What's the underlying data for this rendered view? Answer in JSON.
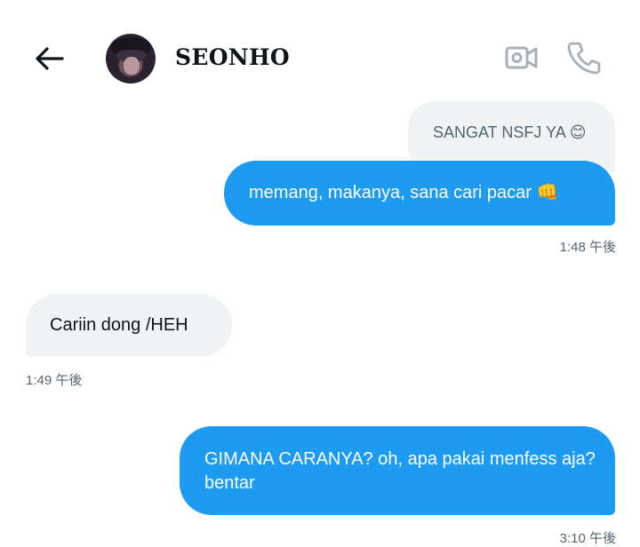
{
  "header": {
    "contact_name": "SEONHO",
    "back_icon": "arrow-left-icon",
    "video_icon": "video-camera-icon",
    "call_icon": "phone-icon",
    "icon_color": "#a7b0b8"
  },
  "messages": [
    {
      "side": "received",
      "text": "SANGAT NSFJ YA 😊"
    },
    {
      "side": "sent",
      "text": "memang, makanya, sana cari pacar 👊"
    },
    {
      "side": "sent",
      "timestamp": "1:48 午後"
    },
    {
      "side": "received",
      "text": "Cariin dong /HEH"
    },
    {
      "side": "received",
      "timestamp": "1:49 午後"
    },
    {
      "side": "sent",
      "text": "GIMANA CARANYA? oh, apa pakai menfess aja? bentar"
    },
    {
      "side": "sent",
      "timestamp": "3:10 午後"
    }
  ],
  "colors": {
    "sent_bubble": "#1d9bf0",
    "received_bubble": "#eff3f4",
    "timestamp": "#536471"
  }
}
